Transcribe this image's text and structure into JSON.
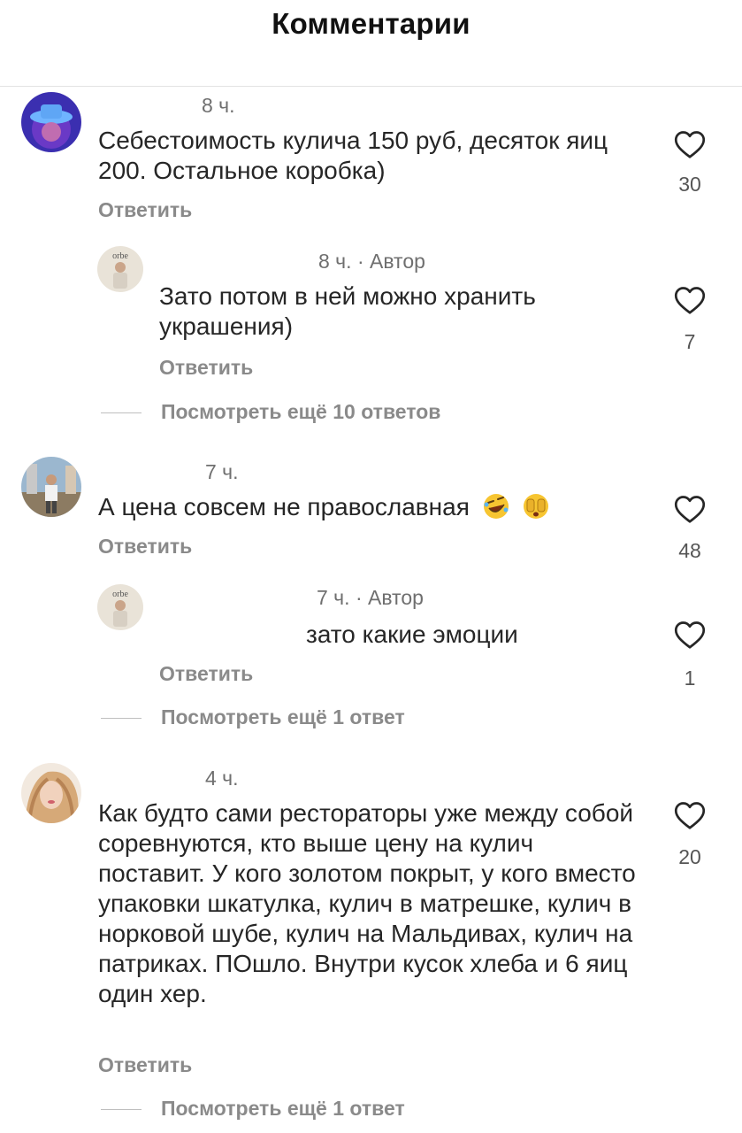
{
  "header": {
    "title": "Комментарии"
  },
  "comments": [
    {
      "meta": "8 ч.",
      "text": "Себестоимость кулича 150 руб, десяток яиц 200. Остальное коробка)",
      "reply": "Ответить",
      "likes": "30"
    },
    {
      "meta": "8 ч. · Автор",
      "text": "Зато потом в ней можно хранить украшения)",
      "reply": "Ответить",
      "likes": "7",
      "more": "Посмотреть ещё 10 ответов"
    },
    {
      "meta": "7 ч.",
      "text": "А цена совсем не православная",
      "emoji_icons": [
        "rolling-laughing-emoji-icon",
        "face-hiding-eyes-emoji-icon"
      ],
      "reply": "Ответить",
      "likes": "48"
    },
    {
      "meta": "7 ч. · Автор",
      "text": "зато какие эмоции",
      "reply": "Ответить",
      "likes": "1",
      "more": "Посмотреть ещё 1 ответ"
    },
    {
      "meta": "4 ч.",
      "text": "Как будто сами рестораторы уже между собой соревнуются, кто выше цену на кулич поставит. У кого золотом покрыт, у кого вместо упаковки шкатулка, кулич в матрешке, кулич в норковой шубе, кулич на Мальдивах, кулич на патриках. ПОшло. Внутри кусок хлеба и 6 яиц один хер.",
      "reply": "Ответить",
      "likes": "20",
      "more": "Посмотреть ещё 1 ответ"
    }
  ],
  "icons": {
    "like": "heart-outline-icon"
  },
  "colors": {
    "text": "#262626",
    "secondary": "#8a8a8a",
    "divider": "#e3e3e3"
  }
}
